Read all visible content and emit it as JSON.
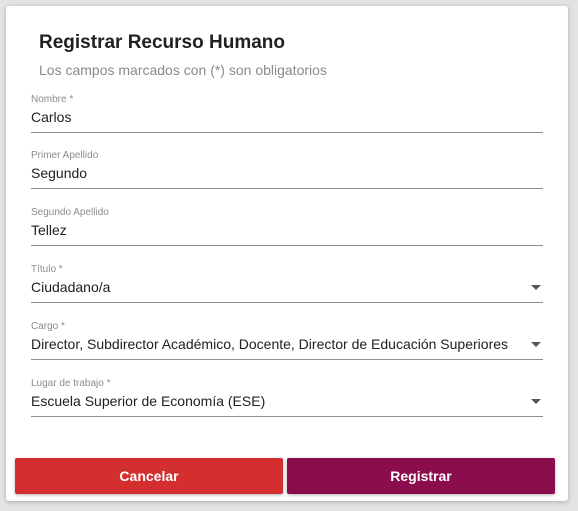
{
  "dialog": {
    "title": "Registrar Recurso Humano",
    "subtitle": "Los campos marcados con (*) son obligatorios"
  },
  "fields": {
    "nombre": {
      "label": "Nombre *",
      "value": "Carlos"
    },
    "primer_apellido": {
      "label": "Primer Apellido",
      "value": "Segundo"
    },
    "segundo_apellido": {
      "label": "Segundo Apellido",
      "value": "Tellez"
    },
    "titulo": {
      "label": "Título *",
      "value": "Ciudadano/a",
      "icon": "dropdown-arrow-icon"
    },
    "cargo": {
      "label": "Cargo *",
      "value": "Director, Subdirector Académico, Docente, Director de Educación Superiores",
      "icon": "dropdown-arrow-icon"
    },
    "lugar": {
      "label": "Lugar de trabajo *",
      "value": "Escuela Superior de Economía (ESE)",
      "icon": "dropdown-arrow-icon"
    }
  },
  "buttons": {
    "cancel_label": "Cancelar",
    "submit_label": "Registrar"
  },
  "colors": {
    "cancel": "#d32f2f",
    "submit": "#8c0d4e"
  }
}
